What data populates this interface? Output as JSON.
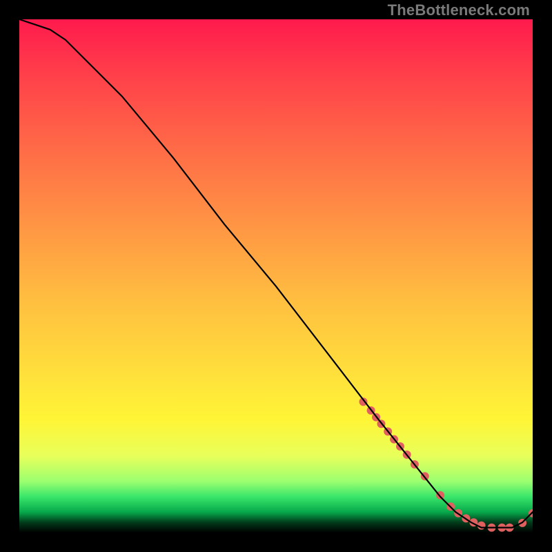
{
  "watermark": "TheBottleneck.com",
  "chart_data": {
    "type": "line",
    "title": "",
    "xlabel": "",
    "ylabel": "",
    "xlim": [
      0,
      100
    ],
    "ylim": [
      0,
      100
    ],
    "grid": false,
    "legend": false,
    "series": [
      {
        "name": "curve",
        "color": "#000000",
        "x": [
          0,
          3,
          6,
          9,
          12,
          15,
          20,
          25,
          30,
          40,
          50,
          60,
          70,
          78,
          82,
          85,
          88,
          90,
          92,
          94,
          96,
          98,
          100
        ],
        "y": [
          100,
          99,
          98,
          96,
          93,
          90,
          85,
          79,
          73,
          60,
          48,
          35,
          22,
          12,
          7,
          4,
          2,
          1,
          1,
          1,
          1,
          2,
          4
        ]
      }
    ],
    "markers": {
      "name": "highlight-points",
      "color": "#e06060",
      "radius": 6,
      "x": [
        67,
        68.5,
        69.5,
        70.5,
        71.8,
        73,
        74.2,
        75.5,
        77,
        79,
        82,
        84,
        85.5,
        87,
        88.5,
        90,
        92,
        94,
        95.5,
        98,
        100
      ],
      "y": [
        25.5,
        23.8,
        22.5,
        21.2,
        19.7,
        18.2,
        16.8,
        15.2,
        13.3,
        11,
        7.3,
        5.1,
        3.8,
        2.8,
        2.0,
        1.4,
        1.0,
        1.0,
        1.0,
        1.9,
        3.8
      ]
    }
  }
}
